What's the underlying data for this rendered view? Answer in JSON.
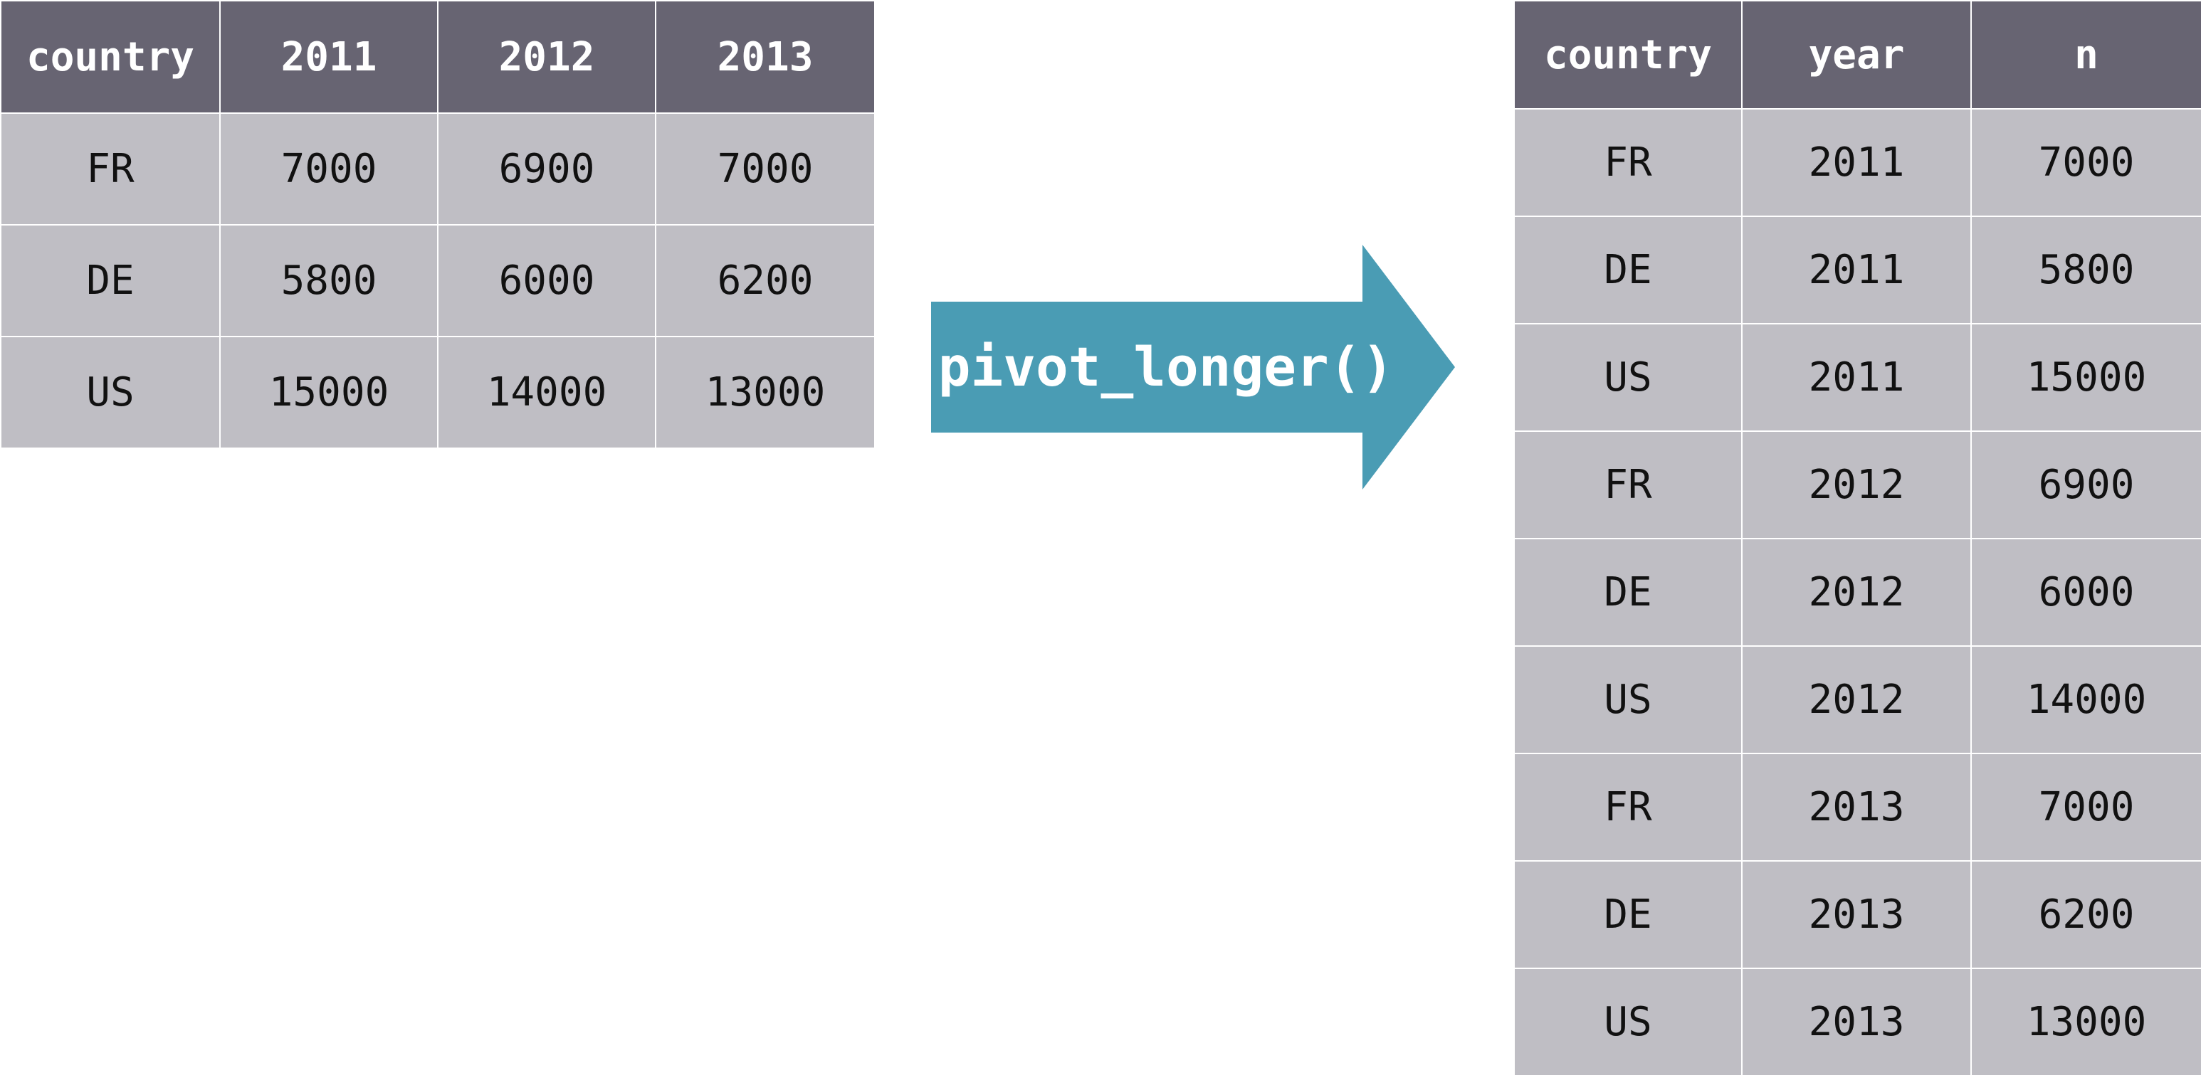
{
  "wide_table": {
    "headers": [
      "country",
      "2011",
      "2012",
      "2013"
    ],
    "rows": [
      [
        "FR",
        "7000",
        "6900",
        "7000"
      ],
      [
        "DE",
        "5800",
        "6000",
        "6200"
      ],
      [
        "US",
        "15000",
        "14000",
        "13000"
      ]
    ]
  },
  "arrow": {
    "label": "pivot_longer()",
    "color": "#4a9cb4"
  },
  "long_table": {
    "headers": [
      "country",
      "year",
      "n"
    ],
    "rows": [
      [
        "FR",
        "2011",
        "7000"
      ],
      [
        "DE",
        "2011",
        "5800"
      ],
      [
        "US",
        "2011",
        "15000"
      ],
      [
        "FR",
        "2012",
        "6900"
      ],
      [
        "DE",
        "2012",
        "6000"
      ],
      [
        "US",
        "2012",
        "14000"
      ],
      [
        "FR",
        "2013",
        "7000"
      ],
      [
        "DE",
        "2013",
        "6200"
      ],
      [
        "US",
        "2013",
        "13000"
      ]
    ]
  },
  "colors": {
    "header_bg": "#676472",
    "cell_bg": "#bfbec4",
    "header_text": "#ffffff",
    "cell_text": "#111111"
  }
}
